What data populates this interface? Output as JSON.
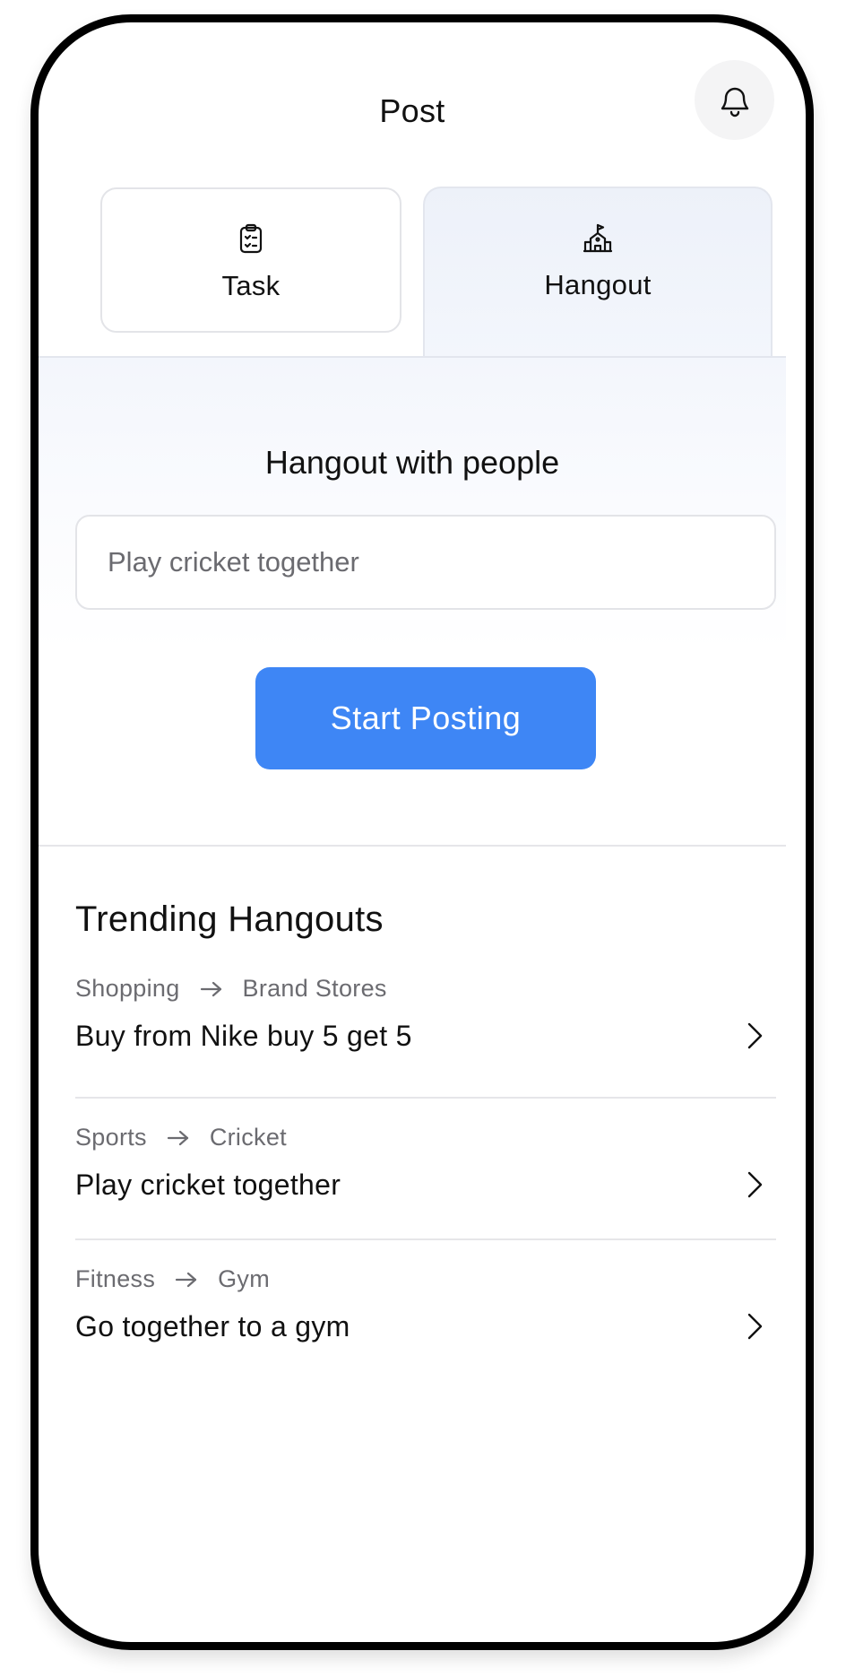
{
  "header": {
    "title": "Post",
    "notification_icon": "bell-icon"
  },
  "tabs": [
    {
      "label": "Task",
      "icon": "clipboard-check-icon",
      "active": false
    },
    {
      "label": "Hangout",
      "icon": "school-building-icon",
      "active": true
    }
  ],
  "panel": {
    "title": "Hangout with people",
    "input_placeholder": "Play cricket together",
    "input_value": "",
    "button_label": "Start Posting"
  },
  "trending": {
    "title": "Trending Hangouts",
    "items": [
      {
        "category": "Shopping",
        "subcategory": "Brand Stores",
        "title": "Buy from Nike buy 5 get 5"
      },
      {
        "category": "Sports",
        "subcategory": "Cricket",
        "title": "Play cricket together"
      },
      {
        "category": "Fitness",
        "subcategory": "Gym",
        "title": "Go together to a gym"
      }
    ]
  },
  "colors": {
    "accent": "#3e86f5",
    "muted_text": "#6b6b70",
    "divider": "#e6e6e9",
    "active_tab_bg": "#edf1f9"
  }
}
